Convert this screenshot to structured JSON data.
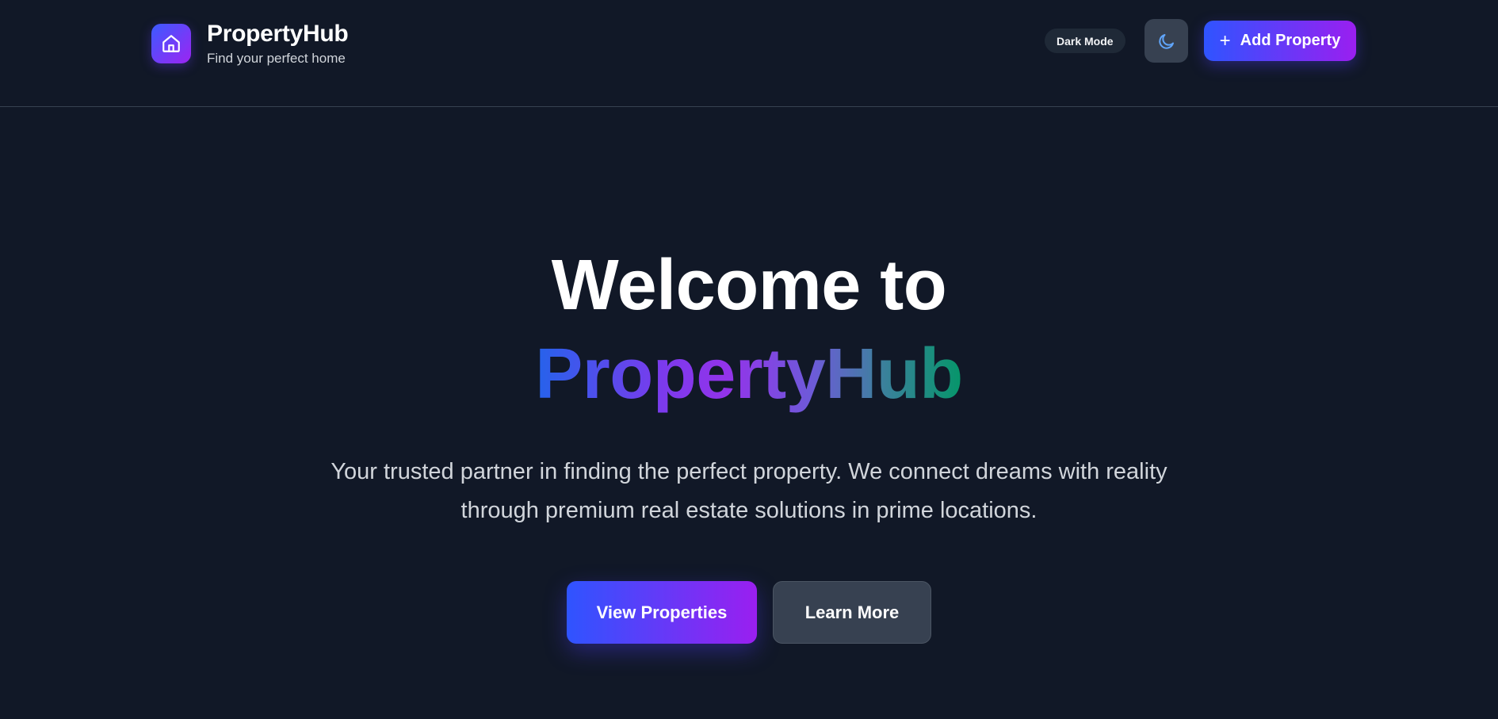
{
  "header": {
    "brand_title": "PropertyHub",
    "brand_subtitle": "Find your perfect home",
    "mode_label": "Dark Mode",
    "add_button_label": "Add Property"
  },
  "hero": {
    "title_line1": "Welcome to",
    "title_line2": "PropertyHub",
    "description": "Your trusted partner in finding the perfect property. We connect dreams with reality through premium real estate solutions in prime locations.",
    "primary_cta": "View Properties",
    "secondary_cta": "Learn More"
  },
  "icons": {
    "logo": "home-icon",
    "theme_toggle": "moon-icon",
    "add": "plus-icon"
  },
  "colors": {
    "background": "#111827",
    "accent_start": "#2f54ff",
    "accent_end": "#9a1ff0",
    "secondary_button": "#374151",
    "moon_icon": "#60a5fa"
  }
}
